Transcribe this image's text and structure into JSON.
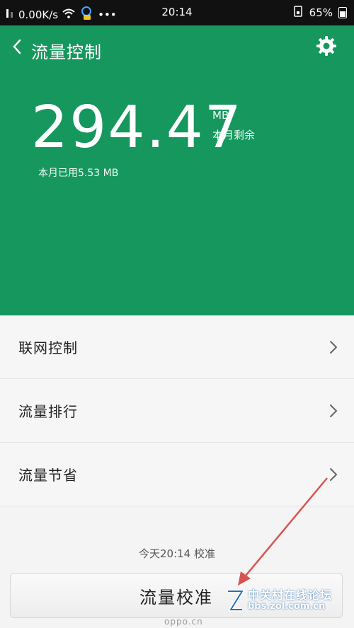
{
  "status_bar": {
    "speed": "0.00K/s",
    "more": "•••",
    "time": "20:14",
    "battery": "65%"
  },
  "header": {
    "title": "流量控制",
    "remaining_value": "294.47",
    "unit": "MB",
    "remaining_label": "本月剩余",
    "used_text": "本月已用5.53 MB",
    "background_color": "#16975e"
  },
  "menu": {
    "items": [
      {
        "label": "联网控制"
      },
      {
        "label": "流量排行"
      },
      {
        "label": "流量节省"
      }
    ]
  },
  "calibration": {
    "last_time": "今天20:14 校准",
    "button_label": "流量校准"
  },
  "watermark": {
    "line1": "中关村在线论坛",
    "line2": "bbs.zol.com.cn",
    "site": "oppo.cn"
  },
  "icons": [
    "back-arrow-icon",
    "gear-icon",
    "chevron-right-icon",
    "wifi-icon",
    "battery-icon",
    "sim-icon",
    "notification-icon"
  ]
}
